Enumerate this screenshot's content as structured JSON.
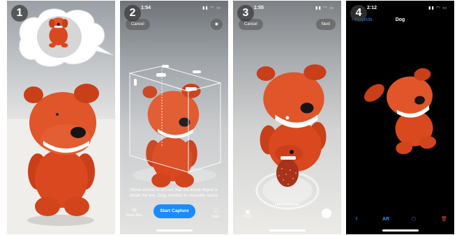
{
  "steps": [
    "1",
    "2",
    "3",
    "4"
  ],
  "panel2": {
    "time": "1:54",
    "cancel": "Cancel",
    "hint": "Move around to ensure that the whole object is inside the box. Drag handles to manually resize.",
    "capture": "Start Capture",
    "reset": "Reset Box",
    "help": "Help"
  },
  "panel3": {
    "time": "1:55",
    "cancel": "Cancel",
    "next": "Next",
    "counter": "6/120"
  },
  "panel4": {
    "time": "2:12",
    "back": "Projects",
    "title": "Dog",
    "ar": "AR"
  },
  "colors": {
    "accent": "#1a8cff",
    "link": "#3a8dff",
    "delete": "#e5493a",
    "plush": "#d9481f"
  }
}
